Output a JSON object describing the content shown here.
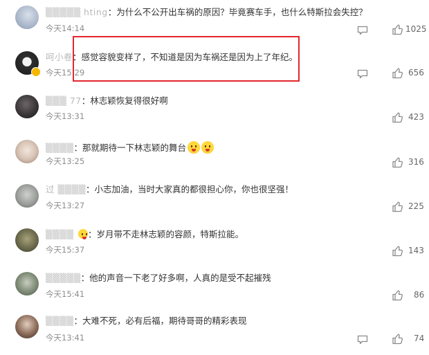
{
  "comments": [
    {
      "username": "hting",
      "text": "为什么不公开出车祸的原因？毕竟赛车手，也什么特斯拉会失控？",
      "time": "今天14:14",
      "likes": "1025",
      "avatar": "#aab6c9"
    },
    {
      "username": "呵小卷",
      "text": "感觉容貌变样了，不知道是因为车祸还是因为上了年纪。",
      "time": "今天15:29",
      "likes": "656",
      "avatar": "#2e2e2e"
    },
    {
      "username": "77",
      "text": "林志颖恢复得很好啊",
      "time": "今天13:31",
      "likes": "423",
      "avatar": "#3a3638"
    },
    {
      "username": "",
      "text": "那就期待一下林志颖的舞台",
      "time": "今天13:25",
      "likes": "316",
      "avatar": "#d8c4b6"
    },
    {
      "username": "过",
      "text": "小志加油，当时大家真的都很担心你，你也很坚强！",
      "time": "今天13:27",
      "likes": "225",
      "avatar": "#9b9e9a"
    },
    {
      "username": "",
      "text": "岁月带不走林志颖的容颜，特斯拉能。",
      "time": "今天15:37",
      "likes": "143",
      "avatar": "#6b6a4c"
    },
    {
      "username": "",
      "text": "他的声音一下老了好多啊，人真的是受不起摧残",
      "time": "今天15:41",
      "likes": "86",
      "avatar": "#7f8b76"
    },
    {
      "username": "",
      "text": "大难不死，必有后福，期待哥哥的精彩表现",
      "time": "今天13:41",
      "likes": "74",
      "avatar": "#8b6a58"
    }
  ]
}
